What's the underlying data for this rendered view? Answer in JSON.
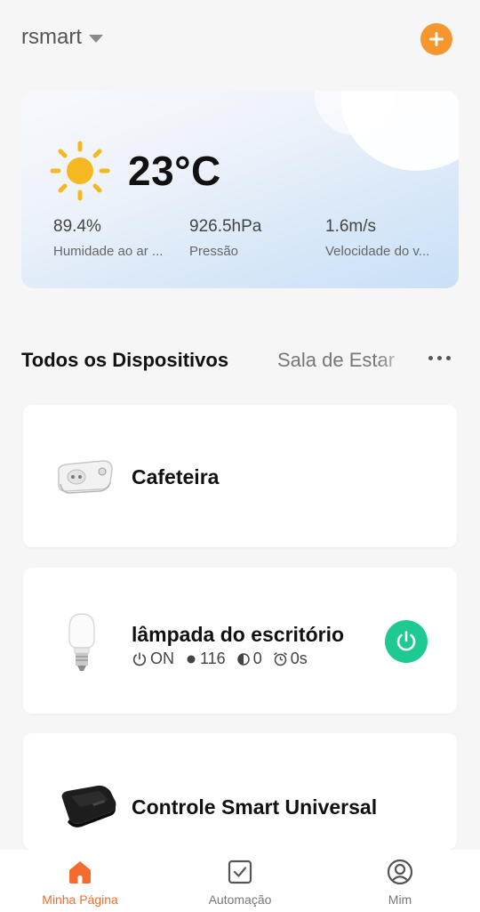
{
  "header": {
    "home_name": "rsmart",
    "add_icon": "plus-icon",
    "accent_color": "#f6962c"
  },
  "weather": {
    "icon": "sun-icon",
    "temperature": "23°C",
    "stats": [
      {
        "value": "89.4%",
        "label": "Humidade ao ar ..."
      },
      {
        "value": "926.5hPa",
        "label": "Pressão"
      },
      {
        "value": "1.6m/s",
        "label": "Velocidade do v..."
      }
    ]
  },
  "tabs": {
    "active": "Todos os Dispositivos",
    "other": "Sala de Estar",
    "more_icon": "more-dots-icon"
  },
  "devices": [
    {
      "name": "Cafeteira",
      "icon": "smart-plug-icon"
    },
    {
      "name": "lâmpada do escritório",
      "icon": "light-bulb-icon",
      "status": {
        "power": "ON",
        "brightness": "116",
        "temperature": "0",
        "timer": "0s"
      },
      "power_color": "#1ec994"
    },
    {
      "name": "Controle Smart Universal",
      "icon": "ir-remote-hub-icon"
    }
  ],
  "nav": [
    {
      "label": "Minha Página",
      "icon": "home-icon",
      "active": true
    },
    {
      "label": "Automação",
      "icon": "checkbox-icon",
      "active": false
    },
    {
      "label": "Mim",
      "icon": "profile-icon",
      "active": false
    }
  ],
  "nav_active_color": "#f46b2f"
}
